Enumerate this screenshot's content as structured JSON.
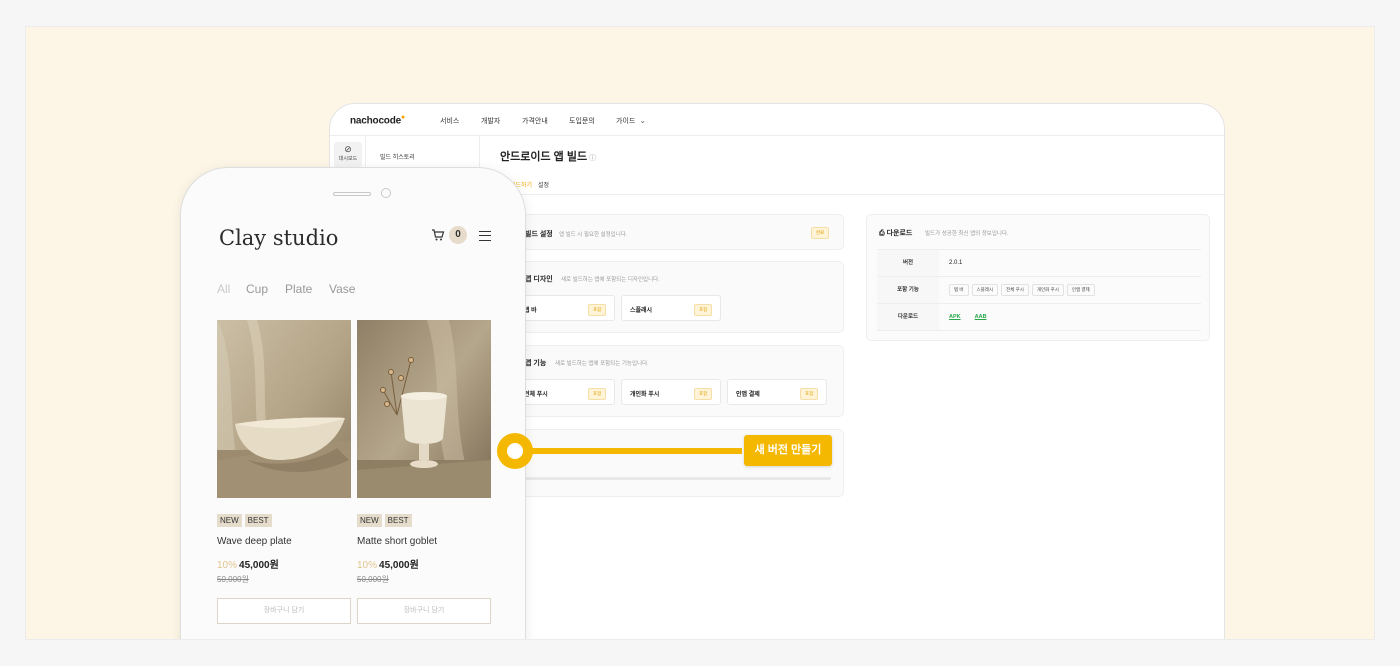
{
  "app": {
    "logo": "nachocode",
    "nav": [
      "서비스",
      "개발자",
      "가격안내",
      "도입문의",
      "가이드"
    ],
    "rail_label": "대시보드",
    "side_menu_item": "빌드 히스토리",
    "page_title": "안드로이드 앱 빌드",
    "tabs": [
      "빌드하기",
      "설정"
    ],
    "sections": [
      {
        "title": "빌드 설정",
        "desc": "앱 빌드 시 필요한 설정입니다.",
        "tag": "완료"
      },
      {
        "title": "앱 디자인",
        "desc": "새로 빌드하는 앱에 포함되는 디자인입니다.",
        "chips": [
          {
            "label": "탭 바",
            "tag": "포함"
          },
          {
            "label": "스플래시",
            "tag": "포함"
          }
        ]
      },
      {
        "title": "앱 기능",
        "desc": "새로 빌드하는 앱에 포함되는 기능입니다.",
        "chips": [
          {
            "label": "전체 푸시",
            "tag": "포함"
          },
          {
            "label": "개인화 푸시",
            "tag": "포함"
          },
          {
            "label": "인앱 결제",
            "tag": "포함"
          }
        ]
      }
    ],
    "download": {
      "title": "다운로드",
      "desc": "빌드가 성공한 최신 앱의 정보입니다.",
      "rows": [
        {
          "key": "버전",
          "value": "2.0.1"
        },
        {
          "key": "포함 기능",
          "features": [
            "탭 바",
            "스플래시",
            "전체 푸시",
            "개인화 푸시",
            "인앱 결제"
          ]
        },
        {
          "key": "다운로드",
          "links": [
            "APK",
            "AAB"
          ]
        }
      ]
    }
  },
  "store": {
    "title": "Clay studio",
    "cart_count": "0",
    "categories": [
      "All",
      "Cup",
      "Plate",
      "Vase"
    ],
    "products": [
      {
        "badges": [
          "NEW",
          "BEST"
        ],
        "name": "Wave deep plate",
        "discount": "10%",
        "price": "45,000원",
        "original": "50,000원",
        "button": "장바구니 담기"
      },
      {
        "badges": [
          "NEW",
          "BEST"
        ],
        "name": "Matte short goblet",
        "discount": "10%",
        "price": "45,000원",
        "original": "50,000원",
        "button": "장바구니 담기"
      }
    ]
  },
  "callout": {
    "button": "새 버전 만들기",
    "color": "#f5b800"
  },
  "colors": {
    "accent": "#f5a300",
    "frame_bg": "#fdf6e6",
    "badge_bg": "#e6dccc"
  }
}
